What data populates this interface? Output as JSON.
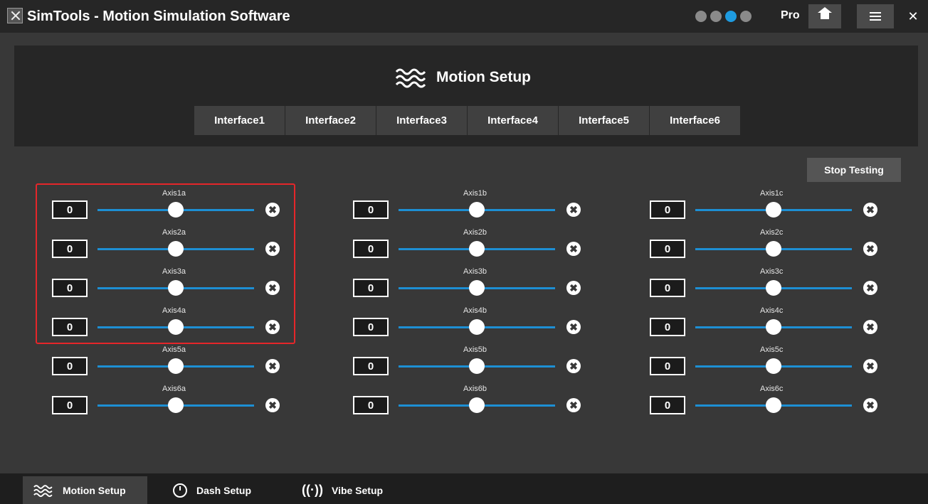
{
  "titlebar": {
    "app_title": "SimTools - Motion Simulation Software",
    "pro_label": "Pro",
    "status_icons": [
      "power-icon",
      "settings-icon",
      "edit-icon",
      "plug-icon"
    ],
    "close_label": "✕"
  },
  "header": {
    "title": "Motion Setup",
    "tabs": [
      "Interface1",
      "Interface2",
      "Interface3",
      "Interface4",
      "Interface5",
      "Interface6"
    ]
  },
  "stop_button": "Stop Testing",
  "axes": {
    "col_a": [
      "Axis1a",
      "Axis2a",
      "Axis3a",
      "Axis4a",
      "Axis5a",
      "Axis6a"
    ],
    "col_b": [
      "Axis1b",
      "Axis2b",
      "Axis3b",
      "Axis4b",
      "Axis5b",
      "Axis6b"
    ],
    "col_c": [
      "Axis1c",
      "Axis2c",
      "Axis3c",
      "Axis4c",
      "Axis5c",
      "Axis6c"
    ],
    "value": "0",
    "slider_level": 0.5,
    "reset_symbol": "✖"
  },
  "bottom_nav": {
    "items": [
      "Motion Setup",
      "Dash Setup",
      "Vibe Setup"
    ],
    "active": "Motion Setup"
  },
  "colors": {
    "accent": "#1d8fd4",
    "highlight": "#e5262a",
    "panel": "#262626",
    "background": "#383838"
  }
}
